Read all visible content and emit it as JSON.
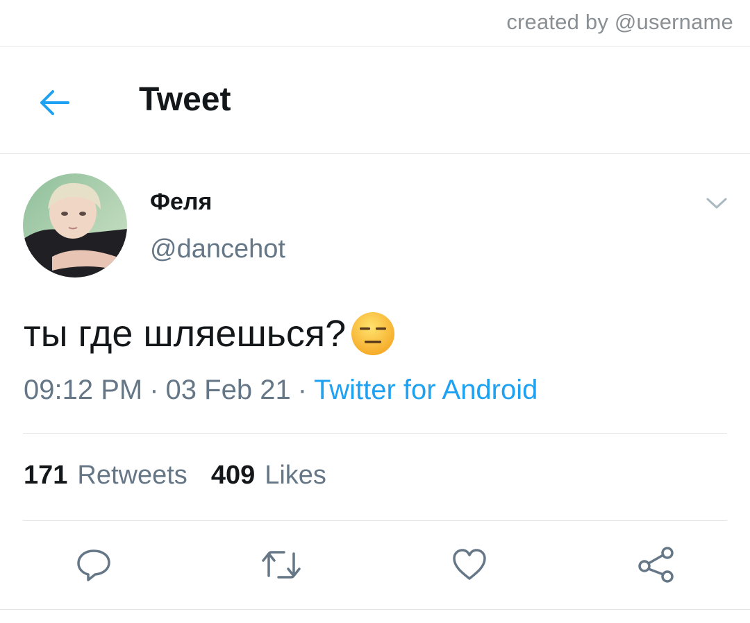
{
  "credit": "created by @username",
  "header": {
    "title": "Tweet"
  },
  "tweet": {
    "display_name": "Феля",
    "handle": "@dancehot",
    "text": "ты где шляешься?",
    "emoji": "expressionless-face",
    "time": "09:12 PM",
    "separator": "·",
    "date": "03 Feb 21",
    "source": "Twitter for Android"
  },
  "stats": {
    "retweets_count": "171",
    "retweets_label": "Retweets",
    "likes_count": "409",
    "likes_label": "Likes"
  },
  "icons": {
    "back": "arrow-left-icon",
    "caret": "chevron-down-icon",
    "reply": "reply-icon",
    "retweet": "retweet-icon",
    "like": "heart-icon",
    "share": "share-icon"
  },
  "colors": {
    "accent": "#1da1f2",
    "secondary_text": "#657786",
    "primary_text": "#14171a",
    "divider": "#e3e6e8"
  }
}
